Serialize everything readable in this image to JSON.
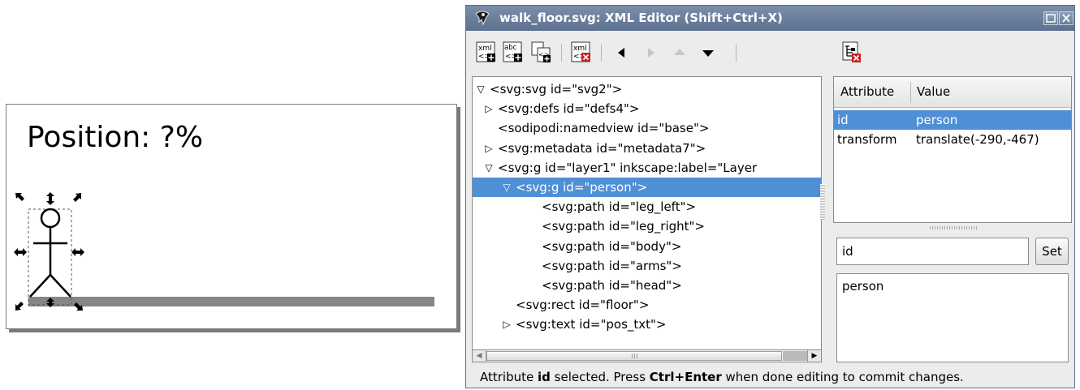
{
  "canvas": {
    "position_text": "Position: ?%"
  },
  "dialog": {
    "title": "walk_floor.svg: XML Editor (Shift+Ctrl+X)",
    "toolbar": {
      "items": [
        {
          "name": "new-element-node-button",
          "icon": "xml-new-node-icon",
          "label": "xml"
        },
        {
          "name": "new-text-node-button",
          "icon": "abc-new-text-icon",
          "label": "abc"
        },
        {
          "name": "duplicate-node-button",
          "icon": "duplicate-node-icon"
        },
        {
          "name": "delete-node-button",
          "icon": "xml-delete-node-icon",
          "label": "xml"
        },
        {
          "name": "unindent-node-button",
          "icon": "arrow-left-icon"
        },
        {
          "name": "indent-node-button",
          "icon": "arrow-right-icon"
        },
        {
          "name": "raise-node-button",
          "icon": "arrow-up-icon"
        },
        {
          "name": "lower-node-button",
          "icon": "arrow-down-icon"
        },
        {
          "name": "delete-attribute-button",
          "icon": "delete-attribute-icon"
        }
      ]
    },
    "tree": {
      "nodes": [
        {
          "text": "<svg:svg id=\"svg2\">",
          "depth": 0,
          "expander": "expanded",
          "selected": false
        },
        {
          "text": "<svg:defs id=\"defs4\">",
          "depth": 1,
          "expander": "collapsed",
          "selected": false
        },
        {
          "text": "<sodipodi:namedview id=\"base\">",
          "depth": 1,
          "expander": "none",
          "selected": false
        },
        {
          "text": "<svg:metadata id=\"metadata7\">",
          "depth": 1,
          "expander": "collapsed",
          "selected": false
        },
        {
          "text": "<svg:g id=\"layer1\" inkscape:label=\"Layer",
          "depth": 1,
          "expander": "expanded",
          "selected": false
        },
        {
          "text": "<svg:g id=\"person\">",
          "depth": 2,
          "expander": "expanded",
          "selected": true
        },
        {
          "text": "<svg:path id=\"leg_left\">",
          "depth": 3,
          "expander": "none",
          "selected": false
        },
        {
          "text": "<svg:path id=\"leg_right\">",
          "depth": 3,
          "expander": "none",
          "selected": false
        },
        {
          "text": "<svg:path id=\"body\">",
          "depth": 3,
          "expander": "none",
          "selected": false
        },
        {
          "text": "<svg:path id=\"arms\">",
          "depth": 3,
          "expander": "none",
          "selected": false
        },
        {
          "text": "<svg:path id=\"head\">",
          "depth": 3,
          "expander": "none",
          "selected": false
        },
        {
          "text": "<svg:rect id=\"floor\">",
          "depth": 2,
          "expander": "none",
          "selected": false
        },
        {
          "text": "<svg:text id=\"pos_txt\">",
          "depth": 2,
          "expander": "collapsed",
          "selected": false
        }
      ]
    },
    "attributes": {
      "header_attribute": "Attribute",
      "header_value": "Value",
      "rows": [
        {
          "name": "id",
          "value": "person",
          "selected": true
        },
        {
          "name": "transform",
          "value": "translate(-290,-467)",
          "selected": false
        }
      ]
    },
    "editor": {
      "name_value": "id",
      "set_label": "Set",
      "value_text": "person"
    },
    "status": {
      "part1": "Attribute ",
      "bold1": "id",
      "part2": " selected. Press ",
      "bold2": "Ctrl+Enter",
      "part3": " when done editing to commit changes."
    }
  }
}
